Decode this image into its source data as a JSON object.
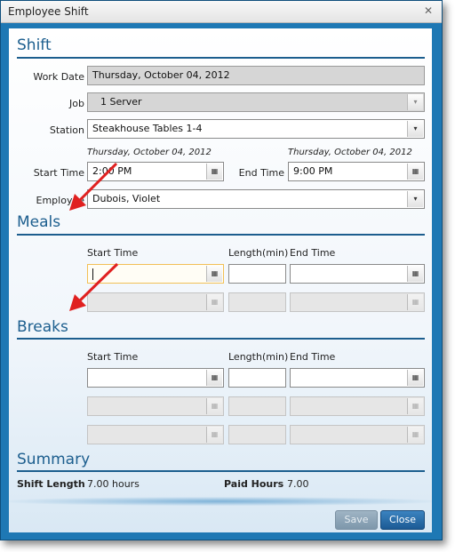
{
  "window": {
    "title": "Employee Shift",
    "close_glyph": "✕"
  },
  "shift": {
    "section_title": "Shift",
    "work_date_label": "Work Date",
    "work_date_value": "Thursday, October 04, 2012",
    "job_label": "Job",
    "job_value": "1 Server",
    "station_label": "Station",
    "station_value": "Steakhouse Tables 1-4",
    "start_day": "Thursday, October 04, 2012",
    "end_day": "Thursday, October 04, 2012",
    "start_time_label": "Start Time",
    "start_time_value": "2:00 PM",
    "end_time_label": "End Time",
    "end_time_value": "9:00 PM",
    "employee_label": "Employee",
    "employee_value": "Dubois, Violet"
  },
  "meals": {
    "section_title": "Meals",
    "col_start": "Start Time",
    "col_length": "Length(min)",
    "col_end": "End Time"
  },
  "breaks": {
    "section_title": "Breaks",
    "col_start": "Start Time",
    "col_length": "Length(min)",
    "col_end": "End Time"
  },
  "summary": {
    "section_title": "Summary",
    "shift_length_label": "Shift Length",
    "shift_length_value": "7.00 hours",
    "paid_hours_label": "Paid Hours",
    "paid_hours_value": "7.00"
  },
  "buttons": {
    "save": "Save",
    "close": "Close"
  },
  "icons": {
    "calendar": "▦",
    "dropdown": "▾",
    "annotation_arrow_color": "#e02020"
  }
}
